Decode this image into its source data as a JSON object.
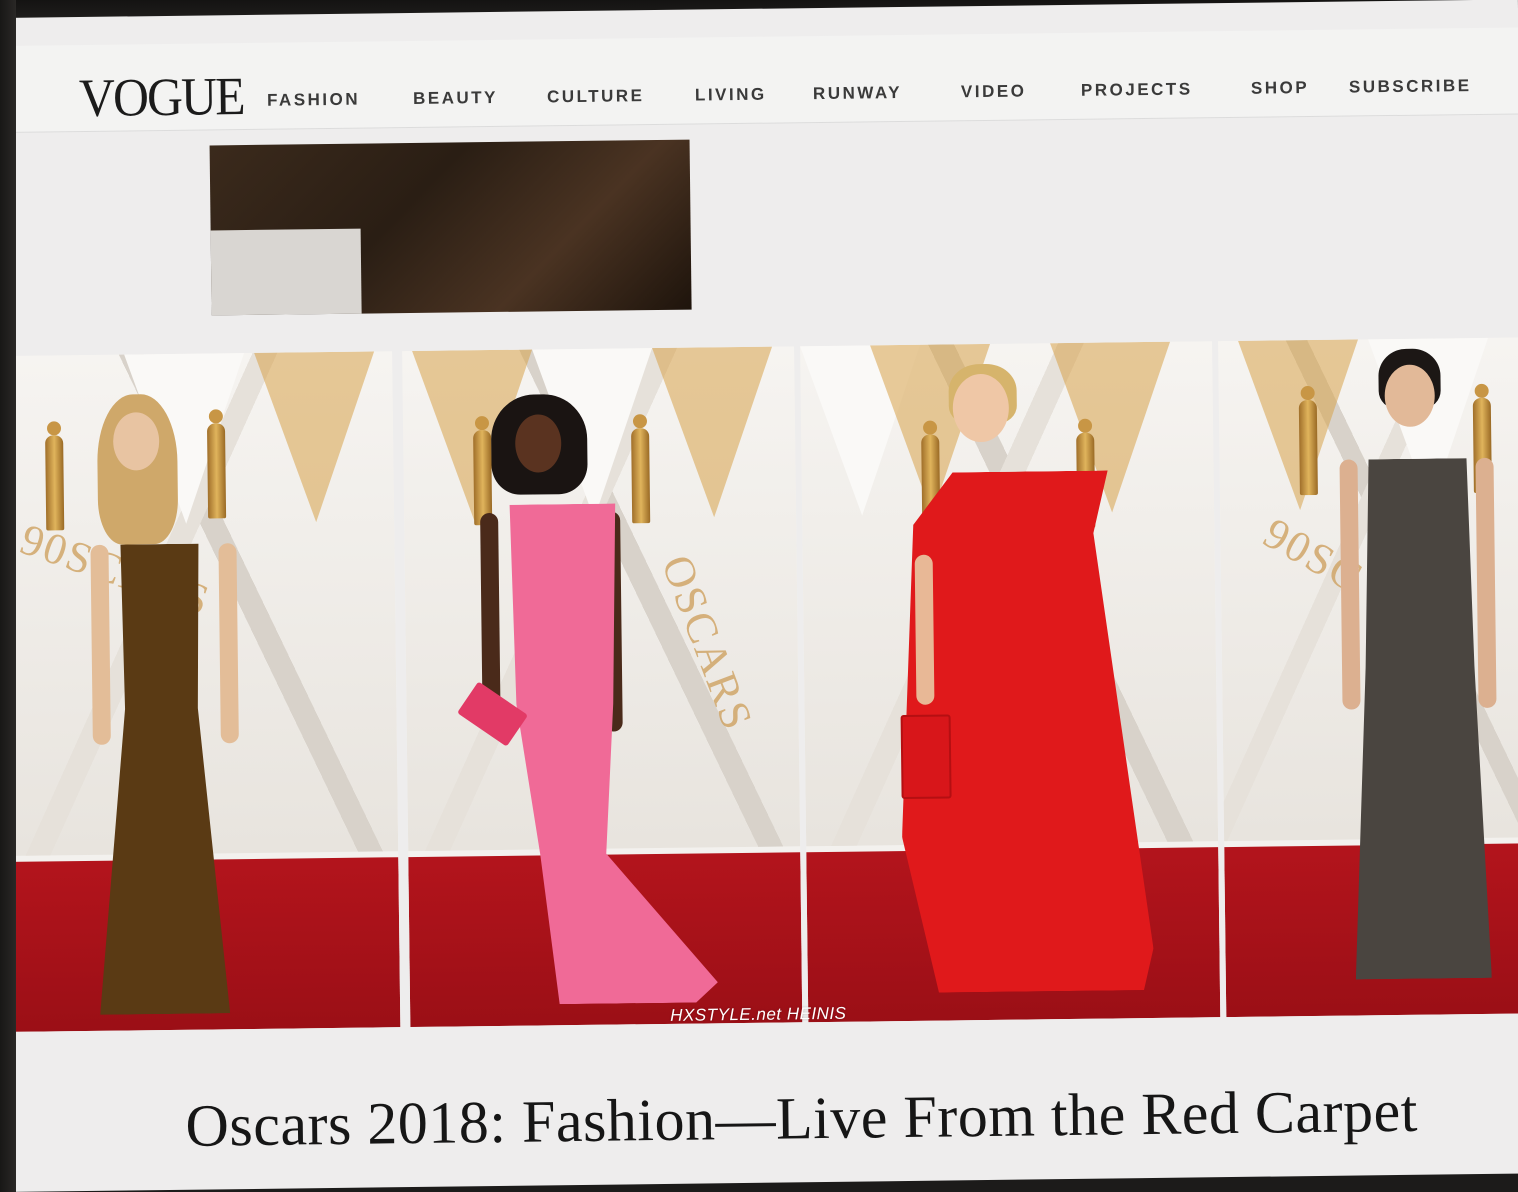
{
  "site": {
    "logo": "VOGUE",
    "accent_color": "#b8373c"
  },
  "nav": {
    "menu_icon": "hamburger-icon",
    "items": [
      "FASHION",
      "BEAUTY",
      "CULTURE",
      "LIVING",
      "RUNWAY",
      "VIDEO",
      "PROJECTS",
      "SHOP",
      "SUBSCRIBE"
    ]
  },
  "gallery": {
    "panels": [
      {
        "gown_color": "#5a3a14",
        "backdrop_text": "90SCARS"
      },
      {
        "gown_color": "#f06a97",
        "backdrop_text": "OSCARS"
      },
      {
        "gown_color": "#e0191b",
        "backdrop_text": ""
      },
      {
        "gown_color": "#4a4540",
        "backdrop_text": "90SC"
      }
    ],
    "watermark": "HXSTYLE.net HEINIS"
  },
  "article": {
    "headline": "Oscars 2018: Fashion—Live From the Red Carpet"
  }
}
